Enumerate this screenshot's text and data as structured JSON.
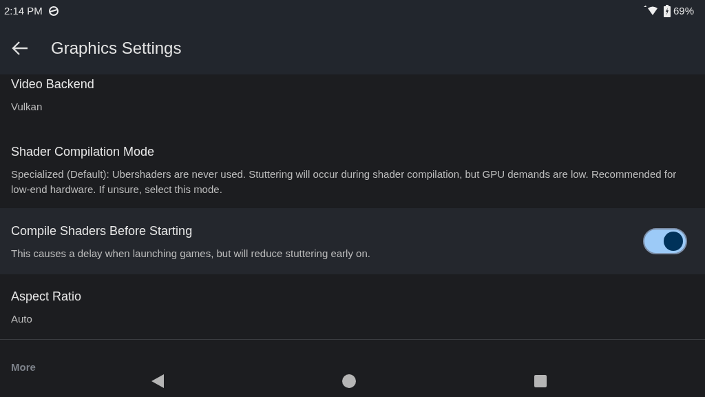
{
  "status_bar": {
    "time": "2:14 PM",
    "battery": "69%"
  },
  "header": {
    "title": "Graphics Settings"
  },
  "settings": [
    {
      "kind": "setting",
      "title": "Video Backend",
      "summary": "Vulkan",
      "selected": false
    },
    {
      "kind": "setting",
      "title": "Shader Compilation Mode",
      "summary": "Specialized (Default): Ubershaders are never used. Stuttering will occur during shader compilation, but GPU demands are low. Recommended for low-end hardware. If unsure, select this mode.",
      "selected": false
    },
    {
      "kind": "switch",
      "title": "Compile Shaders Before Starting",
      "summary": "This causes a delay when launching games, but will reduce stuttering early on.",
      "on": true,
      "selected": true
    },
    {
      "kind": "setting",
      "title": "Aspect Ratio",
      "summary": "Auto",
      "selected": false
    }
  ],
  "section": {
    "title": "More"
  }
}
